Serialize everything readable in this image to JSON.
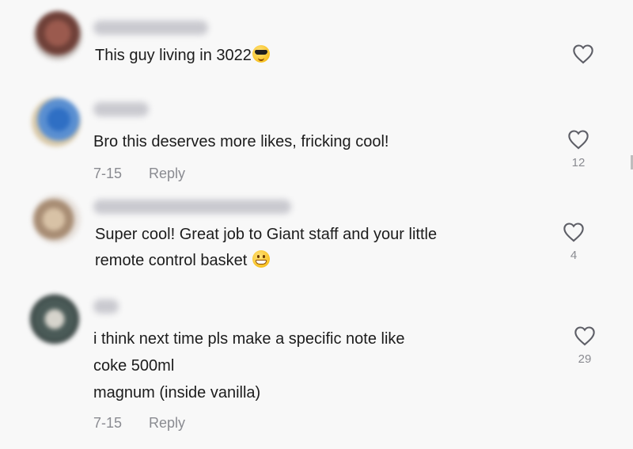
{
  "comments": [
    {
      "username": "Shang Kiss",
      "text": "This guy living in 3022",
      "emoji": "sunglasses-emoji",
      "date": "",
      "reply_label": "",
      "like_count": ""
    },
    {
      "username": "AKT",
      "text": "Bro this deserves more likes, fricking cool!",
      "emoji": "",
      "date": "7-15",
      "reply_label": "Reply",
      "like_count": "12"
    },
    {
      "username": "Baby GB and Mama",
      "text_lines": [
        "Super cool! Great job to Giant staff and your little",
        "remote control basket"
      ],
      "emoji": "grinning-emoji",
      "date": "",
      "reply_label": "",
      "like_count": "4"
    },
    {
      "username": "YE",
      "text_lines": [
        "i think next time pls make a specific note like",
        "coke 500ml",
        "magnum (inside vanilla)"
      ],
      "emoji": "",
      "date": "7-15",
      "reply_label": "Reply",
      "like_count": "29"
    }
  ],
  "icons": {
    "like": "heart-outline-icon"
  },
  "colors": {
    "text": "#1c1c1c",
    "muted": "#8a8b91",
    "background": "#f8f8f8"
  }
}
